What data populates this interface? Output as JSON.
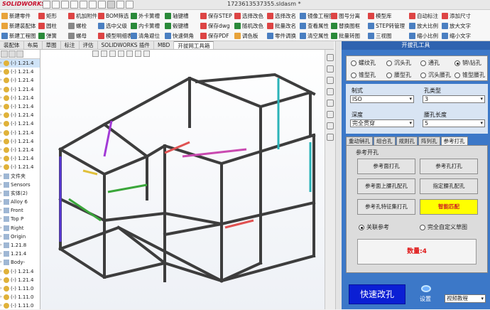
{
  "app": {
    "logo": "SOLIDWORKS",
    "document_title": "1723613537355.sldasm *"
  },
  "ribbon": {
    "buttons": [
      {
        "label": "新建零件",
        "icon": "new-part-icon",
        "color": "#e8a33a"
      },
      {
        "label": "新建装配体",
        "icon": "new-assembly-icon",
        "color": "#e8a33a"
      },
      {
        "label": "新建工程图",
        "icon": "new-drawing-icon",
        "color": "#4a7fc1"
      },
      {
        "label": "矩形",
        "icon": "rectangle-icon",
        "color": "#d44"
      },
      {
        "label": "圆柱",
        "icon": "cylinder-icon",
        "color": "#d44"
      },
      {
        "label": "弹簧",
        "icon": "spring-icon",
        "color": "#2a8a3a"
      },
      {
        "label": "机加附件",
        "icon": "machining-icon",
        "color": "#d44"
      },
      {
        "label": "螺栓",
        "icon": "bolt-icon",
        "color": "#888"
      },
      {
        "label": "螺母",
        "icon": "nut-icon",
        "color": "#888"
      },
      {
        "label": "BOM筛选",
        "icon": "bom-filter-icon",
        "color": "#d44"
      },
      {
        "label": "选中父级",
        "icon": "select-parent-icon",
        "color": "#4a7fc1"
      },
      {
        "label": "模型明细表",
        "icon": "model-table-icon",
        "color": "#d44"
      },
      {
        "label": "外卡簧槽",
        "icon": "outer-circlip-icon",
        "color": "#2a8a3a"
      },
      {
        "label": "内卡簧槽",
        "icon": "inner-circlip-icon",
        "color": "#2a8a3a"
      },
      {
        "label": "清角避位",
        "icon": "corner-relief-icon",
        "color": "#4a7fc1"
      },
      {
        "label": "轴键槽",
        "icon": "shaft-keyway-icon",
        "color": "#2a8a3a"
      },
      {
        "label": "毂键槽",
        "icon": "hub-keyway-icon",
        "color": "#2a8a3a"
      },
      {
        "label": "快速倒角",
        "icon": "quick-chamfer-icon",
        "color": "#4a7fc1"
      },
      {
        "label": "保存STEP",
        "icon": "save-step-icon",
        "color": "#d44"
      },
      {
        "label": "保存dwg",
        "icon": "save-dwg-icon",
        "color": "#d44"
      },
      {
        "label": "保存PDF",
        "icon": "save-pdf-icon",
        "color": "#d44"
      },
      {
        "label": "选择改色",
        "icon": "select-recolor-icon",
        "color": "#d44"
      },
      {
        "label": "随机改色",
        "icon": "random-recolor-icon",
        "color": "#2a8a3a"
      },
      {
        "label": "调色板",
        "icon": "palette-icon",
        "color": "#e8a33a"
      },
      {
        "label": "选择改名",
        "icon": "select-rename-icon",
        "color": "#d44"
      },
      {
        "label": "批量改名",
        "icon": "batch-rename-icon",
        "color": "#d44"
      },
      {
        "label": "零件调换",
        "icon": "swap-part-icon",
        "color": "#4a7fc1"
      },
      {
        "label": "镜像工程图",
        "icon": "mirror-drawing-icon",
        "color": "#4a7fc1"
      },
      {
        "label": "查看属性",
        "icon": "view-properties-icon",
        "color": "#4a7fc1"
      },
      {
        "label": "清空属性",
        "icon": "clear-properties-icon",
        "color": "#4a7fc1"
      },
      {
        "label": "图号分离",
        "icon": "split-number-icon",
        "color": "#d44"
      },
      {
        "label": "替换图框",
        "icon": "replace-frame-icon",
        "color": "#2a8a3a"
      },
      {
        "label": "批量转图",
        "icon": "batch-convert-icon",
        "color": "#2a8a3a"
      },
      {
        "label": "模型库",
        "icon": "model-library-icon",
        "color": "#d44"
      },
      {
        "label": "STEP转管理",
        "icon": "step-manage-icon",
        "color": "#4a7fc1"
      },
      {
        "label": "三视图",
        "icon": "three-view-icon",
        "color": "#4a7fc1"
      },
      {
        "label": "自动标注",
        "icon": "auto-dimension-icon",
        "color": "#d44"
      },
      {
        "label": "放大比例",
        "icon": "zoom-in-scale-icon",
        "color": "#4a7fc1"
      },
      {
        "label": "缩小比例",
        "icon": "zoom-out-scale-icon",
        "color": "#4a7fc1"
      },
      {
        "label": "添加尺寸",
        "icon": "add-dimension-icon",
        "color": "#d44"
      },
      {
        "label": "放大文字",
        "icon": "enlarge-text-icon",
        "color": "#4a7fc1"
      },
      {
        "label": "缩小文字",
        "icon": "shrink-text-icon",
        "color": "#4a7fc1"
      }
    ]
  },
  "tabs": [
    "装配体",
    "布局",
    "草图",
    "标注",
    "评估",
    "SOLIDWORKS 插件",
    "MBD",
    "开拔网工具箱"
  ],
  "active_tab": 7,
  "feature_tree": [
    "(-) 1.21.4",
    "(-) 1.21.4",
    "(-) 1.21.4",
    "(-) 1.21.4",
    "(-) 1.21.4",
    "(-) 1.21.4",
    "(-) 1.21.4",
    "(-) 1.21.4",
    "(-) 1.21.4",
    "(-) 1.21.4",
    "(-) 1.21.4",
    "(-) 1.21.4",
    "(-) 1.21.4",
    "文件夹",
    "Sensors",
    "实体(2)",
    "Alloy 6",
    "Front",
    "Top P",
    "Right",
    "Origin",
    "1.21.8",
    "1.21.4",
    "Body-",
    "(-) 1.21.4",
    "(-) 1.21.4",
    "(-) 1.11.0",
    "(-) 1.11.0",
    "(-) 1.11.0"
  ],
  "panel": {
    "title": "开拔孔工具",
    "hole_types": [
      {
        "label": "螺纹孔",
        "checked": false
      },
      {
        "label": "沉头孔",
        "checked": false
      },
      {
        "label": "通孔",
        "checked": false
      },
      {
        "label": "销\\钻孔",
        "checked": true
      },
      {
        "label": "锥型孔",
        "checked": false
      },
      {
        "label": "腰型孔",
        "checked": false
      },
      {
        "label": "沉头腰孔",
        "checked": false
      },
      {
        "label": "锥型腰孔",
        "checked": false
      }
    ],
    "standard_label": "制式",
    "standard_value": "ISO",
    "hole_type_label": "孔类型",
    "hole_type_value": "3",
    "depth_label": "深度",
    "depth_value": "完全贯穿",
    "slot_len_label": "腰孔长度",
    "slot_len_value": "5",
    "subtabs": [
      "重动销孔",
      "组合孔",
      "规则孔",
      "阵列孔",
      "参考打孔"
    ],
    "active_subtab": 4,
    "group_label": "参考开孔",
    "buttons": [
      "参考面打孔",
      "参考孔打孔",
      "参考面上腰孔配孔",
      "指定腰孔配孔",
      "参考孔特征集打孔",
      "智能匹配"
    ],
    "ref_radio": "关联参考",
    "free_radio": "完全自定义草图",
    "count_text": "数量:4",
    "quick_button": "快速改孔",
    "settings_label": "设置",
    "video_select": "视频教程"
  }
}
